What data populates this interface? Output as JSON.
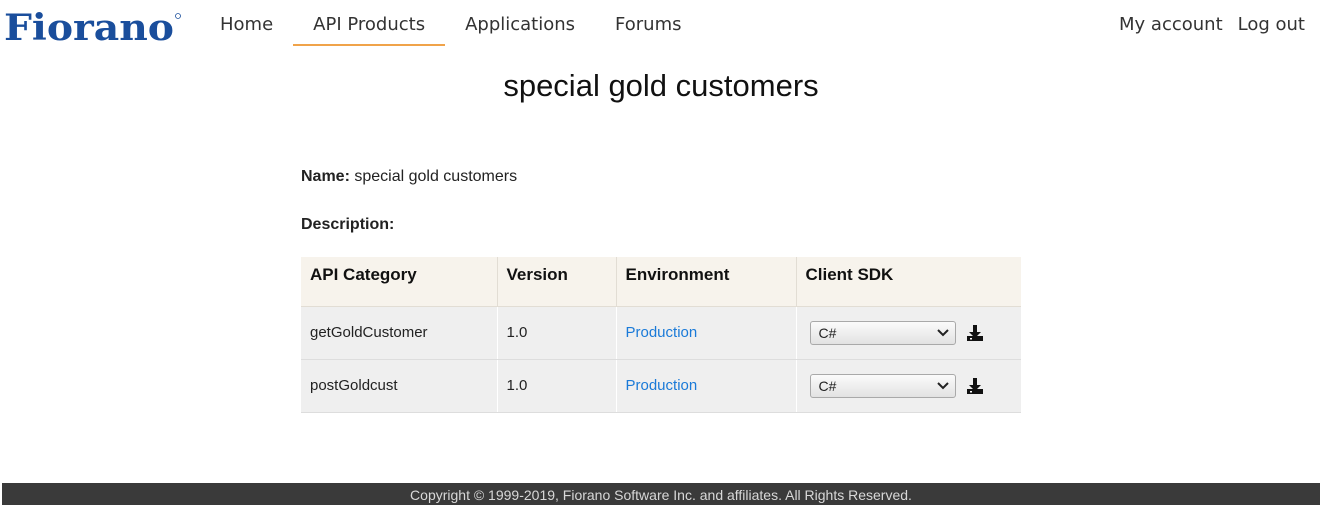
{
  "brand": {
    "logo_text": "Fiorano",
    "logo_color": "#1a4e9c"
  },
  "nav": {
    "items": [
      {
        "label": "Home",
        "active": false
      },
      {
        "label": "API Products",
        "active": true
      },
      {
        "label": "Applications",
        "active": false
      },
      {
        "label": "Forums",
        "active": false
      }
    ],
    "right": [
      {
        "label": "My account"
      },
      {
        "label": "Log out"
      }
    ],
    "active_underline_color": "#f0a34a"
  },
  "page": {
    "title": "special gold customers",
    "name_label": "Name:",
    "name_value": "special gold customers",
    "description_label": "Description:"
  },
  "table": {
    "headers": [
      "API Category",
      "Version",
      "Environment",
      "Client SDK"
    ],
    "rows": [
      {
        "category": "getGoldCustomer",
        "version": "1.0",
        "environment": "Production",
        "sdk": "C#"
      },
      {
        "category": "postGoldcust",
        "version": "1.0",
        "environment": "Production",
        "sdk": "C#"
      }
    ],
    "link_color": "#1a7ad8"
  },
  "icons": {
    "dropdown": "chevron-down-icon",
    "download": "download-icon"
  },
  "footer": {
    "text": "Copyright © 1999-2019, Fiorano Software Inc. and affiliates. All Rights Reserved."
  }
}
